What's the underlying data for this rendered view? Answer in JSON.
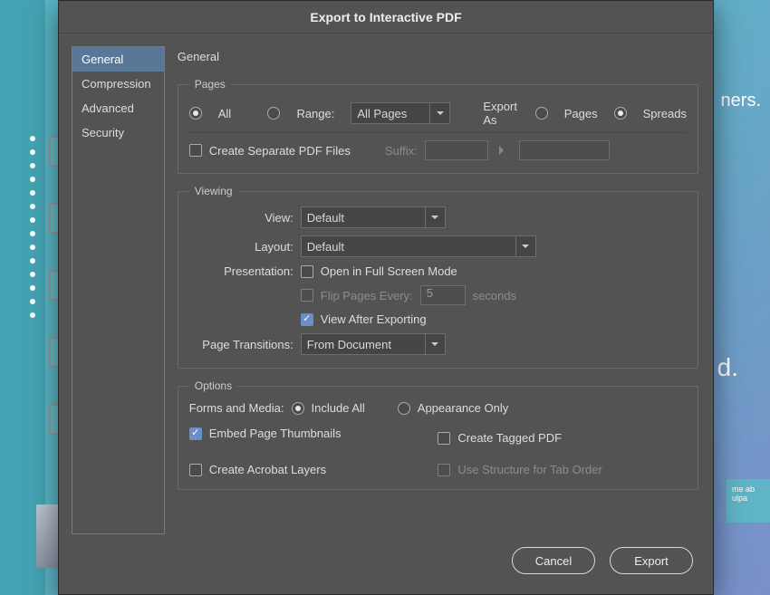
{
  "dialog": {
    "title": "Export to Interactive PDF"
  },
  "sidebar": {
    "items": [
      {
        "label": "General",
        "active": true
      },
      {
        "label": "Compression",
        "active": false
      },
      {
        "label": "Advanced",
        "active": false
      },
      {
        "label": "Security",
        "active": false
      }
    ]
  },
  "panel": {
    "heading": "General",
    "pages": {
      "legend": "Pages",
      "all_label": "All",
      "all_selected": true,
      "range_label": "Range:",
      "range_selected": false,
      "range_value": "All Pages",
      "export_as_label": "Export As",
      "pages_label": "Pages",
      "pages_selected": false,
      "spreads_label": "Spreads",
      "spreads_selected": true,
      "separate_files_label": "Create Separate PDF Files",
      "separate_files_checked": false,
      "suffix_label": "Suffix:",
      "suffix_value": ""
    },
    "viewing": {
      "legend": "Viewing",
      "view_label": "View:",
      "view_value": "Default",
      "layout_label": "Layout:",
      "layout_value": "Default",
      "presentation_label": "Presentation:",
      "fullscreen_label": "Open in Full Screen Mode",
      "fullscreen_checked": false,
      "flip_label": "Flip Pages Every:",
      "flip_enabled": false,
      "flip_value": "5",
      "flip_seconds": "seconds",
      "view_after_label": "View After Exporting",
      "view_after_checked": true,
      "transitions_label": "Page Transitions:",
      "transitions_value": "From Document"
    },
    "options": {
      "legend": "Options",
      "forms_label": "Forms and Media:",
      "include_all_label": "Include All",
      "include_all_selected": true,
      "appearance_label": "Appearance Only",
      "appearance_selected": false,
      "embed_thumbs_label": "Embed Page Thumbnails",
      "embed_thumbs_checked": true,
      "tagged_pdf_label": "Create Tagged PDF",
      "tagged_pdf_checked": false,
      "acrobat_layers_label": "Create Acrobat Layers",
      "acrobat_layers_checked": false,
      "structure_tab_label": "Use Structure for Tab Order",
      "structure_tab_enabled": false
    }
  },
  "footer": {
    "cancel": "Cancel",
    "export": "Export"
  },
  "background": {
    "ners": "ners.",
    "d": "d.",
    "swatch": "me ab\nulpa"
  }
}
